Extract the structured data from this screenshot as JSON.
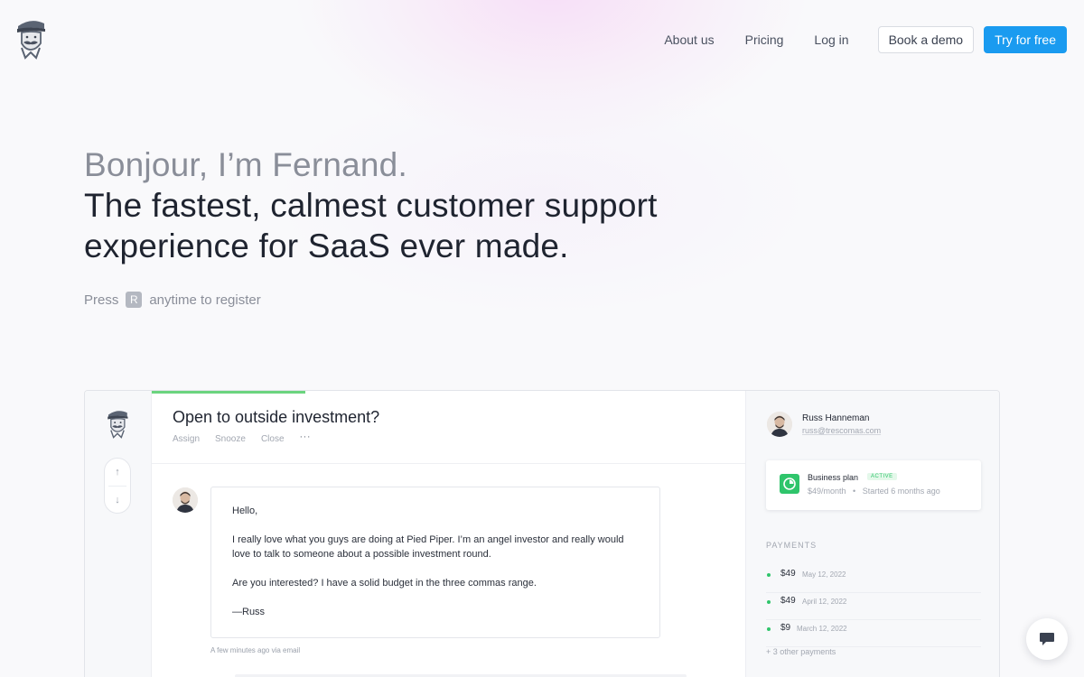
{
  "nav": {
    "links": [
      "About us",
      "Pricing",
      "Log in"
    ],
    "book_demo": "Book a demo",
    "try_free": "Try for free"
  },
  "hero": {
    "greeting": "Bonjour, I’m Fernand.",
    "headline": "The fastest, calmest customer support experience for SaaS ever made.",
    "hint_prefix": "Press",
    "hint_key": "R",
    "hint_suffix": "anytime to register"
  },
  "app": {
    "ticket": {
      "title": "Open to outside investment?",
      "actions": [
        "Assign",
        "Snooze",
        "Close"
      ],
      "more": "···",
      "message": {
        "greeting": "Hello,",
        "body1": "I really love what you guys are doing at Pied Piper. I’m an angel investor and really would love to talk to someone about a possible investment round.",
        "body2": "Are you interested? I have a solid budget in the three commas range.",
        "signature": "—Russ"
      },
      "meta": "A few minutes ago via email"
    },
    "customer": {
      "name": "Russ Hanneman",
      "email": "russ@trescomas.com",
      "plan": {
        "name": "Business plan",
        "status": "ACTIVE",
        "price": "$49/month",
        "separator": "•",
        "started": "Started 6 months ago"
      },
      "payments_title": "PAYMENTS",
      "payments": [
        {
          "amount": "$49",
          "date": "May 12, 2022"
        },
        {
          "amount": "$49",
          "date": "April 12, 2022"
        },
        {
          "amount": "$9",
          "date": "March 12, 2022"
        }
      ],
      "other_payments": "+ 3 other payments"
    }
  },
  "colors": {
    "accent": "#1a9bf0",
    "success": "#2fc56b",
    "progress": "#6bd47f"
  }
}
